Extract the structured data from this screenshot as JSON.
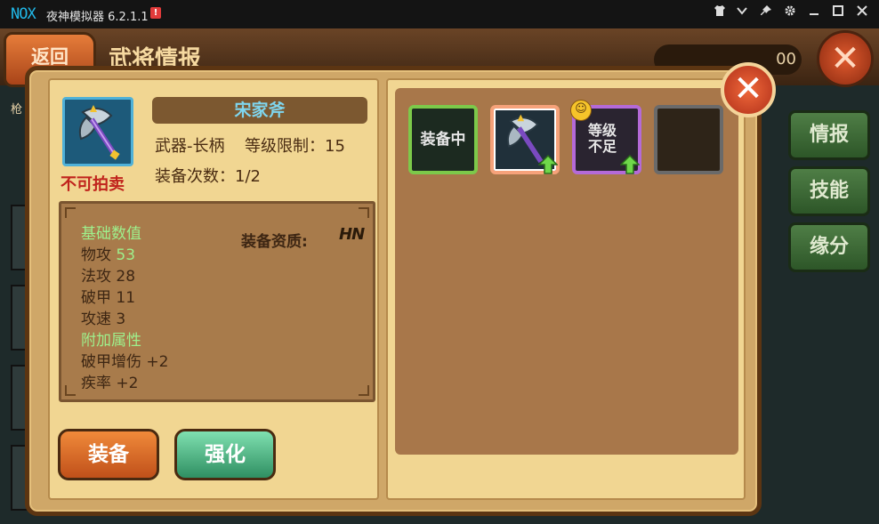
{
  "window": {
    "logo": "NOX",
    "title": "夜神模拟器 6.2.1.1",
    "alert_badge": "!",
    "controls": [
      "shirt-icon",
      "chevron-down-icon",
      "pin-icon",
      "gear-icon",
      "minimize-icon",
      "maximize-icon",
      "close-icon"
    ]
  },
  "background": {
    "back_label": "返回",
    "screen_title": "武将情报",
    "currency_value": "00",
    "left_tab_label": "枪",
    "side_tabs": [
      "情报",
      "技能",
      "缘分"
    ]
  },
  "item": {
    "name": "宋家斧",
    "tradable_status": "不可拍卖",
    "type": "武器-长柄",
    "level_limit_label": "等级限制：15",
    "equip_count_label": "装备次数：1/2",
    "quality_label": "装备资质:",
    "quality_mark": "HN"
  },
  "stats": {
    "base_header": "基础数值",
    "base": [
      {
        "label": "物攻",
        "value": "53",
        "highlight": true
      },
      {
        "label": "法攻",
        "value": "28",
        "highlight": false
      },
      {
        "label": "破甲",
        "value": "11",
        "highlight": false
      },
      {
        "label": "攻速",
        "value": "3",
        "highlight": false
      }
    ],
    "extra_header": "附加属性",
    "extra": [
      {
        "label": "破甲增伤",
        "value": "+2"
      },
      {
        "label": "疾率",
        "value": "+2"
      }
    ]
  },
  "buttons": {
    "equip": "装备",
    "enhance": "强化"
  },
  "slots": {
    "equipped_label": "装备中",
    "level_insufficient_label": "等级不足"
  },
  "colors": {
    "name_text": "#7fd6ef",
    "status_red": "#c0231c",
    "stat_highlight": "#9ef08c"
  }
}
